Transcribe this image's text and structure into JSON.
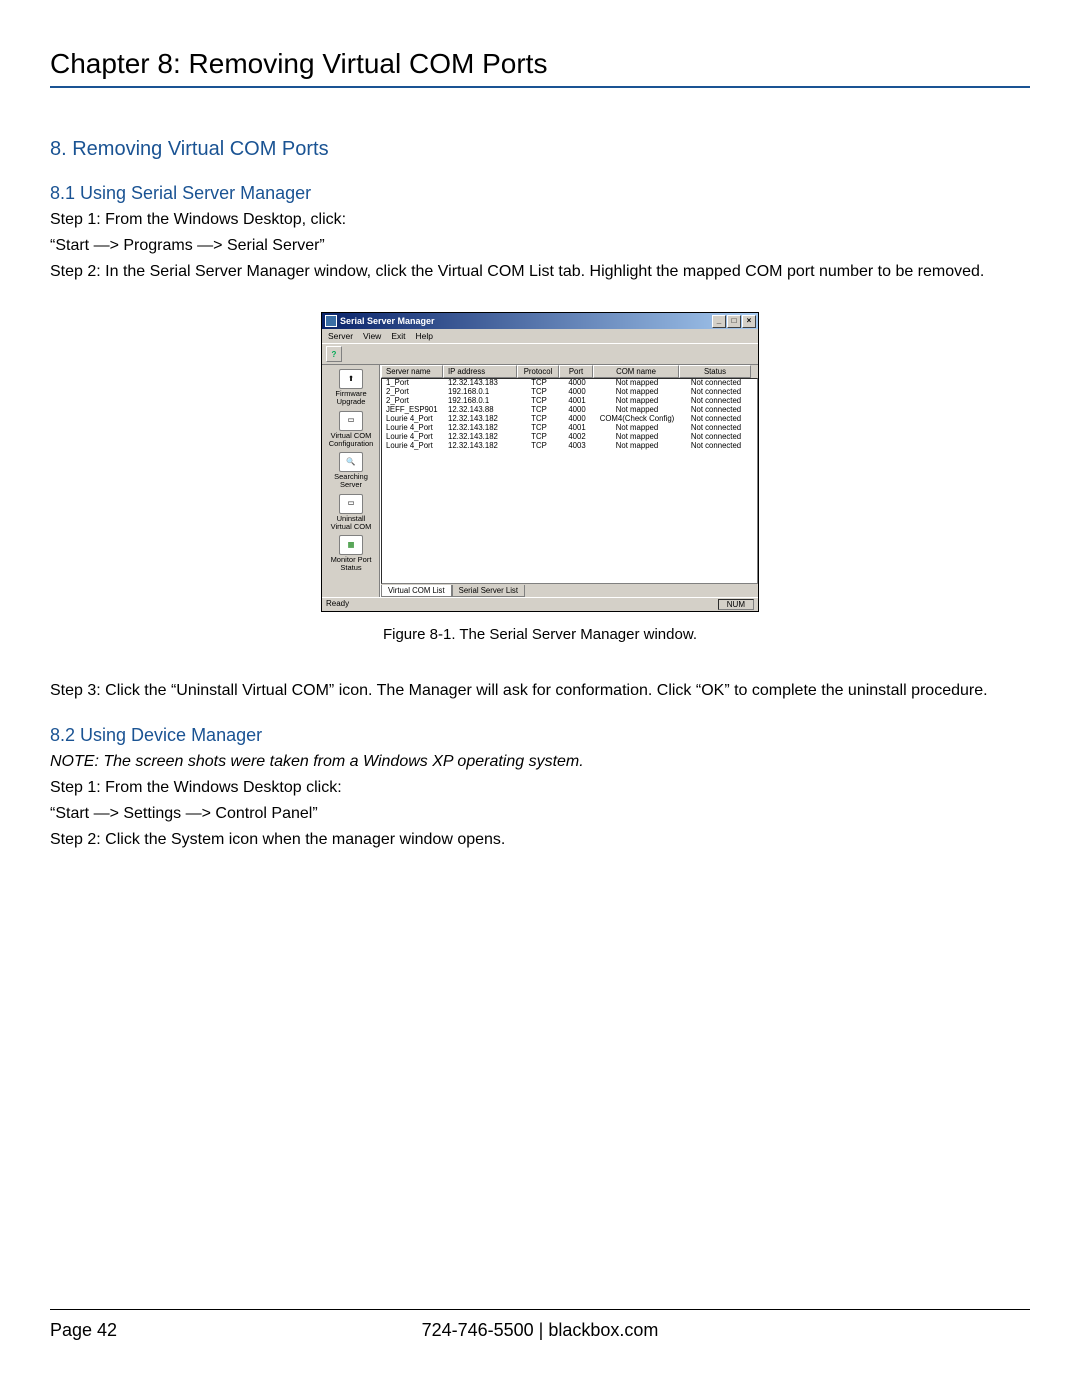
{
  "chapter_title": "Chapter 8: Removing Virtual COM Ports",
  "h1": "8. Removing Virtual COM Ports",
  "sec81_title": "8.1 Using Serial Server Manager",
  "sec81_step1": "Step 1: From the Windows Desktop, click:",
  "sec81_path": "“Start —> Programs —> Serial Server”",
  "sec81_step2": "Step 2: In the Serial Server Manager window, click the Virtual COM List tab. Highlight the mapped COM port number to be removed.",
  "figure_caption": "Figure 8-1. The Serial Server Manager window.",
  "sec81_step3": "Step 3: Click the “Uninstall Virtual COM” icon. The Manager will ask for conformation. Click “OK” to complete the uninstall procedure.",
  "sec82_title": "8.2 Using Device Manager",
  "sec82_note": "NOTE: The screen shots were taken from a Windows XP operating system.",
  "sec82_step1": "Step 1: From the Windows Desktop click:",
  "sec82_path": "“Start  —> Settings  —> Control Panel”",
  "sec82_step2": "Step 2: Click the System icon when the manager window opens.",
  "footer": {
    "page": "Page 42",
    "phone_site": "724-746-5500   |   blackbox.com"
  },
  "screenshot": {
    "title": "Serial Server Manager",
    "menu": [
      "Server",
      "View",
      "Exit",
      "Help"
    ],
    "sidebar": [
      {
        "label": "Firmware Upgrade"
      },
      {
        "label": "Virtual COM Configuration"
      },
      {
        "label": "Searching Server"
      },
      {
        "label": "Uninstall Virtual COM"
      },
      {
        "label": "Monitor Port Status"
      }
    ],
    "columns": [
      "Server name",
      "IP address",
      "Protocol",
      "Port",
      "COM name",
      "Status"
    ],
    "rows": [
      {
        "name": "1_Port",
        "ip": "12.32.143.183",
        "prot": "TCP",
        "port": "4000",
        "com": "Not mapped",
        "stat": "Not connected"
      },
      {
        "name": "2_Port",
        "ip": "192.168.0.1",
        "prot": "TCP",
        "port": "4000",
        "com": "Not mapped",
        "stat": "Not connected"
      },
      {
        "name": "2_Port",
        "ip": "192.168.0.1",
        "prot": "TCP",
        "port": "4001",
        "com": "Not mapped",
        "stat": "Not connected"
      },
      {
        "name": "JEFF_ESP901",
        "ip": "12.32.143.88",
        "prot": "TCP",
        "port": "4000",
        "com": "Not mapped",
        "stat": "Not connected"
      },
      {
        "name": "Lourie 4_Port",
        "ip": "12.32.143.182",
        "prot": "TCP",
        "port": "4000",
        "com": "COM4(Check Config)",
        "stat": "Not connected"
      },
      {
        "name": "Lourie 4_Port",
        "ip": "12.32.143.182",
        "prot": "TCP",
        "port": "4001",
        "com": "Not mapped",
        "stat": "Not connected"
      },
      {
        "name": "Lourie 4_Port",
        "ip": "12.32.143.182",
        "prot": "TCP",
        "port": "4002",
        "com": "Not mapped",
        "stat": "Not connected"
      },
      {
        "name": "Lourie 4_Port",
        "ip": "12.32.143.182",
        "prot": "TCP",
        "port": "4003",
        "com": "Not mapped",
        "stat": "Not connected"
      }
    ],
    "tabs": {
      "active": "Virtual COM List",
      "inactive": "Serial Server List"
    },
    "status_left": "Ready",
    "status_right": "NUM"
  }
}
